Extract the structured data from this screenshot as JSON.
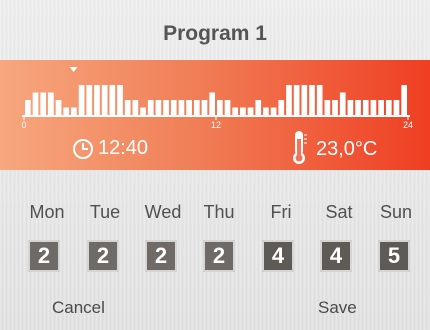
{
  "header": {
    "title": "Program 1"
  },
  "schedule": {
    "axis_ticks": [
      "0",
      "12",
      "24"
    ],
    "bar_levels": [
      2,
      3,
      3,
      3,
      2,
      1,
      1,
      4,
      4,
      4,
      4,
      4,
      4,
      2,
      2,
      1,
      2,
      2,
      2,
      2,
      2,
      2,
      2,
      2,
      3,
      2,
      2,
      1,
      1,
      1,
      2,
      1,
      1,
      2,
      4,
      4,
      4,
      4,
      4,
      2,
      2,
      3,
      2,
      2,
      2,
      2,
      2,
      2,
      2,
      4
    ],
    "current_time": "12:40",
    "temperature": "23,0°C",
    "marker_hour": 3.1,
    "colors": {
      "bar": "#ffffff",
      "band_start": "#f7a77e",
      "band_end": "#ef3e22"
    }
  },
  "days": [
    {
      "name": "Mon",
      "program": "2"
    },
    {
      "name": "Tue",
      "program": "2"
    },
    {
      "name": "Wed",
      "program": "2"
    },
    {
      "name": "Thu",
      "program": "2"
    },
    {
      "name": "Fri",
      "program": "4"
    },
    {
      "name": "Sat",
      "program": "4"
    },
    {
      "name": "Sun",
      "program": "5"
    }
  ],
  "actions": {
    "cancel": "Cancel",
    "save": "Save"
  },
  "icons": {
    "clock": "clock-icon",
    "thermometer": "thermometer-icon"
  }
}
